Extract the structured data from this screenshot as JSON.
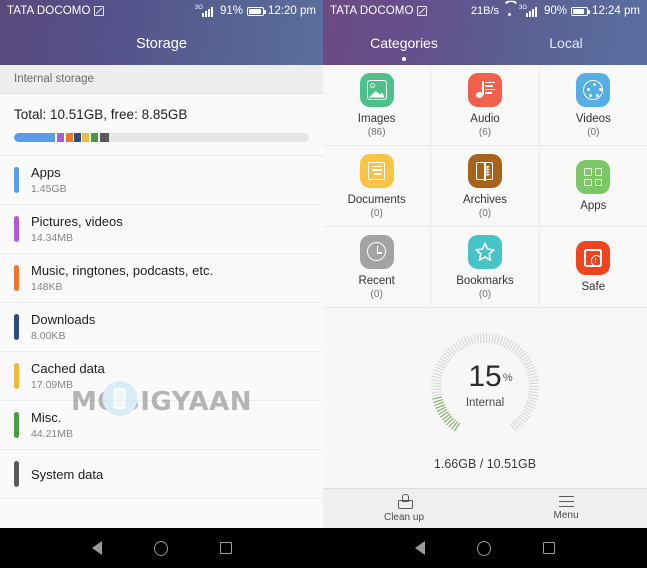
{
  "left": {
    "statusbar": {
      "carrier": "TATA DOCOMO",
      "battery_pct": "91%",
      "time": "12:20 pm",
      "network_type": "3G"
    },
    "header_title": "Storage",
    "section_header": "Internal storage",
    "total_text": "Total: 10.51GB, free: 8.85GB",
    "bar_segments": [
      {
        "name": "apps",
        "color": "#5b9be8",
        "width_pct": 13.8
      },
      {
        "name": "gap",
        "color": "#ffffff",
        "width_pct": 0.7
      },
      {
        "name": "pictures",
        "color": "#b05bd6",
        "width_pct": 2.4
      },
      {
        "name": "gap2",
        "color": "#ffffff",
        "width_pct": 0.6
      },
      {
        "name": "music",
        "color": "#ee7530",
        "width_pct": 2.4
      },
      {
        "name": "gap3",
        "color": "#ffffff",
        "width_pct": 0.6
      },
      {
        "name": "downloads",
        "color": "#2e4d7d",
        "width_pct": 2.1
      },
      {
        "name": "gap4",
        "color": "#ffffff",
        "width_pct": 0.6
      },
      {
        "name": "cached",
        "color": "#efbb3c",
        "width_pct": 2.4
      },
      {
        "name": "gap5",
        "color": "#ffffff",
        "width_pct": 0.6
      },
      {
        "name": "misc",
        "color": "#4b9a42",
        "width_pct": 2.4
      },
      {
        "name": "gap6",
        "color": "#ffffff",
        "width_pct": 0.6
      },
      {
        "name": "system",
        "color": "#5a5a5a",
        "width_pct": 3.0
      }
    ],
    "items": [
      {
        "name": "Apps",
        "size": "1.45GB",
        "color": "#5b9be8"
      },
      {
        "name": "Pictures, videos",
        "size": "14.34MB",
        "color": "#b05bd6"
      },
      {
        "name": "Music, ringtones, podcasts, etc.",
        "size": "148KB",
        "color": "#ee7530"
      },
      {
        "name": "Downloads",
        "size": "8.00KB",
        "color": "#2e4d7d"
      },
      {
        "name": "Cached data",
        "size": "17.09MB",
        "color": "#efbb3c"
      },
      {
        "name": "Misc.",
        "size": "44.21MB",
        "color": "#4b9a42"
      },
      {
        "name": "System data",
        "size": "",
        "color": "#5a5a5a"
      }
    ],
    "watermark": "MOBIGYAAN"
  },
  "right": {
    "statusbar": {
      "carrier": "TATA DOCOMO",
      "netspeed": "21B/s",
      "battery_pct": "90%",
      "time": "12:24 pm",
      "network_type": "3G"
    },
    "tabs": [
      {
        "label": "Categories",
        "active": true
      },
      {
        "label": "Local",
        "active": false
      }
    ],
    "grid": [
      [
        {
          "label": "Images",
          "count": "(86)",
          "icon": "image-icon",
          "color": "#4ec08a"
        },
        {
          "label": "Audio",
          "count": "(6)",
          "icon": "music-note-icon",
          "color": "#f0604d"
        },
        {
          "label": "Videos",
          "count": "(0)",
          "icon": "film-reel-icon",
          "color": "#56aee4"
        }
      ],
      [
        {
          "label": "Documents",
          "count": "(0)",
          "icon": "document-icon",
          "color": "#f7c445"
        },
        {
          "label": "Archives",
          "count": "(0)",
          "icon": "archive-icon",
          "color": "#a8631a"
        },
        {
          "label": "Apps",
          "count": "",
          "icon": "apps-grid-icon",
          "color": "#7ac765"
        }
      ],
      [
        {
          "label": "Recent",
          "count": "(0)",
          "icon": "clock-icon",
          "color": "#a3a3a3"
        },
        {
          "label": "Bookmarks",
          "count": "(0)",
          "icon": "star-icon",
          "color": "#46c3c4"
        },
        {
          "label": "Safe",
          "count": "",
          "icon": "safe-icon",
          "color": "#f0441e"
        }
      ]
    ],
    "gauge": {
      "percent": "15",
      "percent_symbol": "%",
      "label": "Internal",
      "used_total": "1.66GB / 10.51GB",
      "fill_pct": 15,
      "fill_color": "#7fae6a",
      "track_color": "#d8d8d8"
    },
    "toolbar": [
      {
        "label": "Clean up",
        "icon": "brush-icon"
      },
      {
        "label": "Menu",
        "icon": "hamburger-icon"
      }
    ]
  },
  "navbar": {
    "back": "back-icon",
    "home": "home-icon",
    "recent": "recents-icon"
  }
}
